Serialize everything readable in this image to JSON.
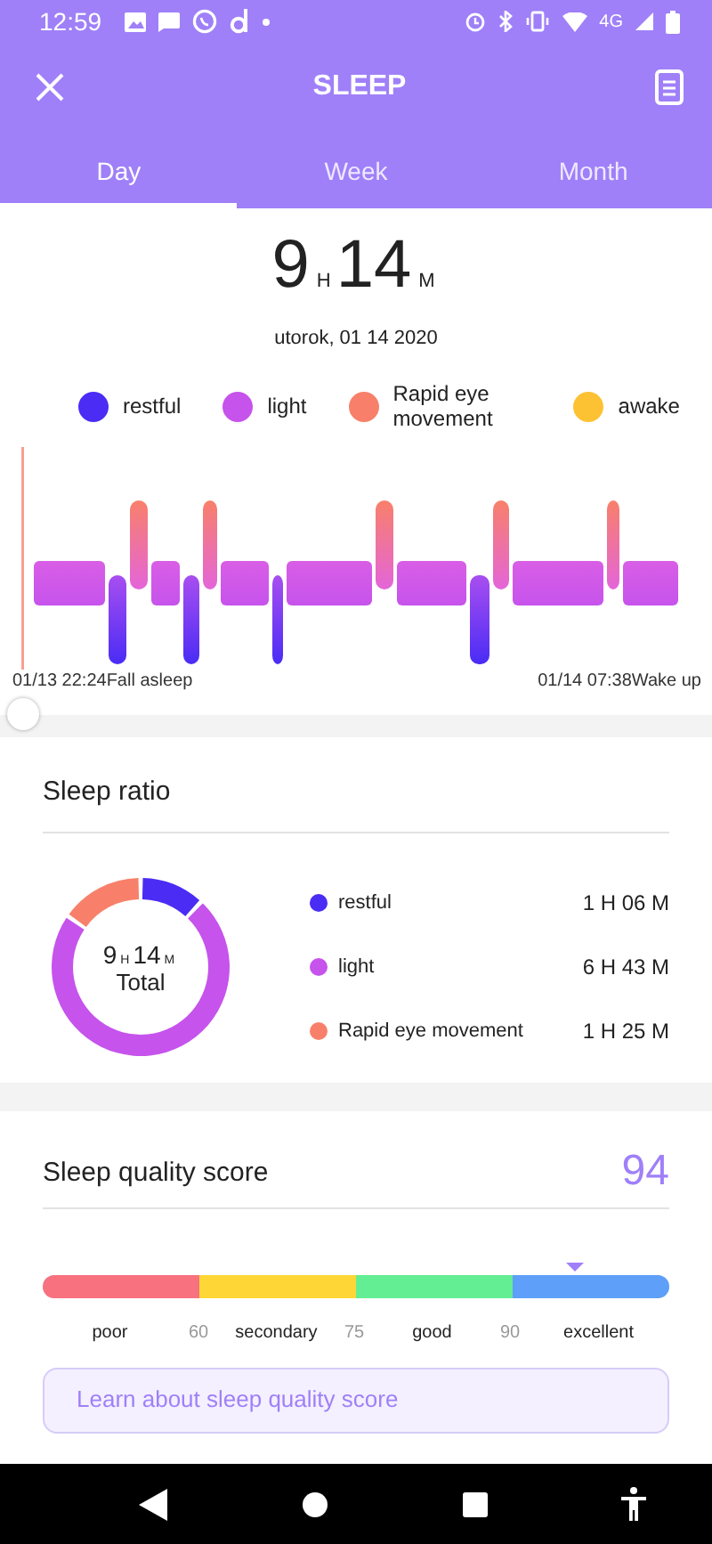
{
  "status_bar": {
    "time": "12:59",
    "network": "4G"
  },
  "header": {
    "title": "SLEEP"
  },
  "tabs": [
    {
      "label": "Day",
      "selected": true
    },
    {
      "label": "Week",
      "selected": false
    },
    {
      "label": "Month",
      "selected": false
    }
  ],
  "summary": {
    "hours": "9",
    "hours_unit": "H",
    "minutes": "14",
    "minutes_unit": "M",
    "date": "utorok, 01 14 2020"
  },
  "legend": [
    {
      "label": "restful",
      "color": "#4a2cf5"
    },
    {
      "label": "light",
      "color": "#c653ec"
    },
    {
      "label": "Rapid eye movement",
      "color": "#f8806a"
    },
    {
      "label": "awake",
      "color": "#fdc233"
    }
  ],
  "timeline": {
    "start": "01/13 22:24Fall asleep",
    "end": "01/14 07:38Wake up",
    "slider": {
      "level": 0
    }
  },
  "sleep_ratio": {
    "title": "Sleep ratio",
    "total": {
      "hours": "9",
      "hours_unit": "H",
      "minutes": "14",
      "minutes_unit": "M",
      "label": "Total"
    },
    "chart_data": {
      "type": "donut",
      "categories": [
        "restful",
        "light",
        "Rapid eye movement"
      ],
      "values": [
        11.9,
        72.8,
        15.3
      ]
    },
    "items": [
      {
        "color": "#4a2cf5",
        "value": "1 H 06 M"
      },
      {
        "color": "#c653ec",
        "value": "6 H 43 M"
      },
      {
        "color": "#f8806a",
        "value": "1 H 25 M"
      }
    ]
  },
  "quality": {
    "title": "Sleep quality score",
    "score": "94",
    "level": 0.85,
    "bands": [
      {
        "label": "poor",
        "color": "#f8717f"
      },
      {
        "label": "secondary",
        "color": "#fed736"
      },
      {
        "label": "good",
        "color": "#63ee93"
      },
      {
        "label": "excellent",
        "color": "#5d9ff9"
      }
    ],
    "thresholds": [
      "60",
      "75",
      "90"
    ],
    "link": "Learn about sleep quality score"
  }
}
